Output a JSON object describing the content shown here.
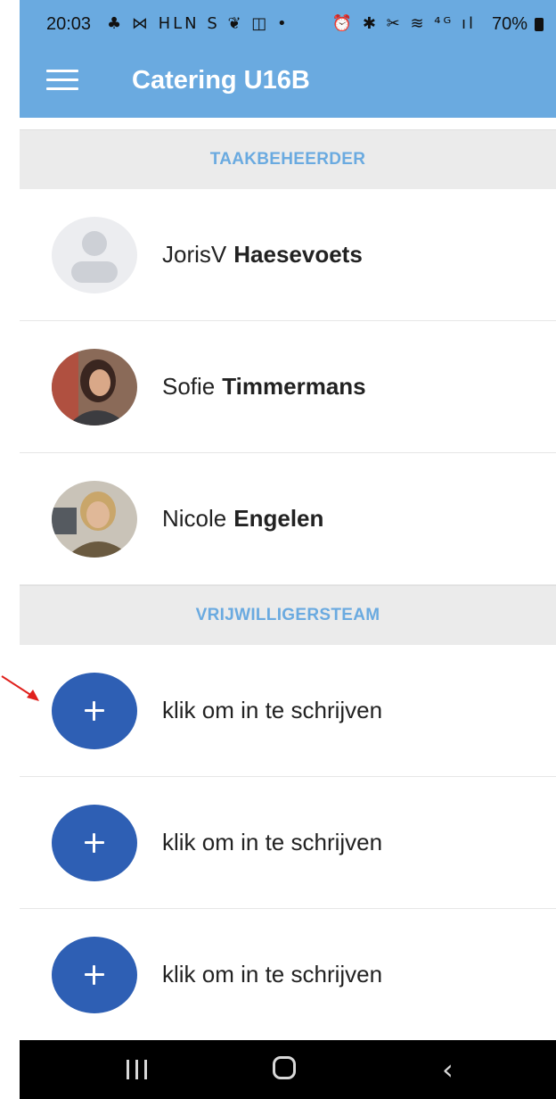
{
  "status_bar": {
    "time": "20:03",
    "left_icons": "♣ ⋈ HLN S ❦ ◫ •",
    "right_icons": "⏰ ✱ ✂ ≋ ⁴ᴳ ıl",
    "battery": "70%"
  },
  "app_bar": {
    "title": "Catering U16B"
  },
  "sections": {
    "managers": "TAAKBEHEERDER",
    "volunteers": "VRIJWILLIGERSTEAM"
  },
  "managers": [
    {
      "first": "JorisV",
      "last": "Haesevoets"
    },
    {
      "first": "Sofie",
      "last": "Timmermans"
    },
    {
      "first": "Nicole",
      "last": "Engelen"
    }
  ],
  "volunteers": [
    {
      "label": "klik om in te schrijven"
    },
    {
      "label": "klik om in te schrijven"
    },
    {
      "label": "klik om in te schrijven"
    }
  ],
  "colors": {
    "app_bar": "#6aaae0",
    "section_header_text": "#6aaae0",
    "plus_button": "#2e5fb4",
    "annotation_arrow": "#e0201c"
  },
  "icons": {
    "menu": "hamburger-menu-icon",
    "plus": "plus-icon",
    "default_avatar": "person-placeholder-icon"
  }
}
